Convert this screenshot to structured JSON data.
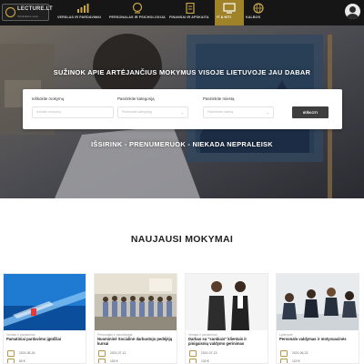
{
  "brand": {
    "name": "LECTURE.LT",
    "tagline": "Tobulinkime save",
    "accent": "#a08229"
  },
  "nav": [
    {
      "label": "VERSLAS IR PARDAVIMAI",
      "icon": "chart-icon",
      "active": false
    },
    {
      "label": "PERSONALAS IR PSICHOLOGIJA",
      "icon": "head-icon",
      "active": false
    },
    {
      "label": "FINANSAI IR APSKAITA",
      "icon": "document-icon",
      "active": false
    },
    {
      "label": "IT & KITI",
      "icon": "monitor-icon",
      "active": true
    },
    {
      "label": "KALBOS",
      "icon": "globe-icon",
      "active": false
    }
  ],
  "hero": {
    "heading": "SUŽINOK APIE ARTĖJANČIUS MOKYMUS VISOJE LIETUVOJE JAU DABAR",
    "tagline": "IŠSIRINK - PRENUMERUOK - NIEKADA NEPRALEISK"
  },
  "search": {
    "keyword_label": "Ieškokite mokymų",
    "keyword_placeholder": "Įveskite mokymų",
    "category_label": "Pasirinkite kategoriją",
    "category_placeholder": "Pasirinkite kategoriją",
    "city_label": "Pasirinkite miestą",
    "city_placeholder": "Pasirinkite miestą",
    "button_label": "IEŠKOTI"
  },
  "section": {
    "title": "NAUJAUSI MOKYMAI"
  },
  "courses": [
    {
      "category": "Verslas ir pardavimai",
      "title": "Pamatiniai pardavimo įgūdžiai",
      "date": "2021-06-16",
      "price": "80 €"
    },
    {
      "category": "Personalas ir psichologija",
      "title": "Nuomininė Socialinė darbuotojo pedėjėjų kursai",
      "date": "2021-07-12",
      "price": "150 €"
    },
    {
      "category": "Verslas ir pardavimai",
      "title": "Darbas su \"sunkiais\" klientais ir pinigaisnių valdymo gerinimas",
      "date": "2021-07-13",
      "price": "130 €"
    },
    {
      "category": "Lyderystė",
      "title": "Personalo valdymas ir motyvuacinės",
      "date": "2021-06-23",
      "price": "120 €"
    }
  ]
}
